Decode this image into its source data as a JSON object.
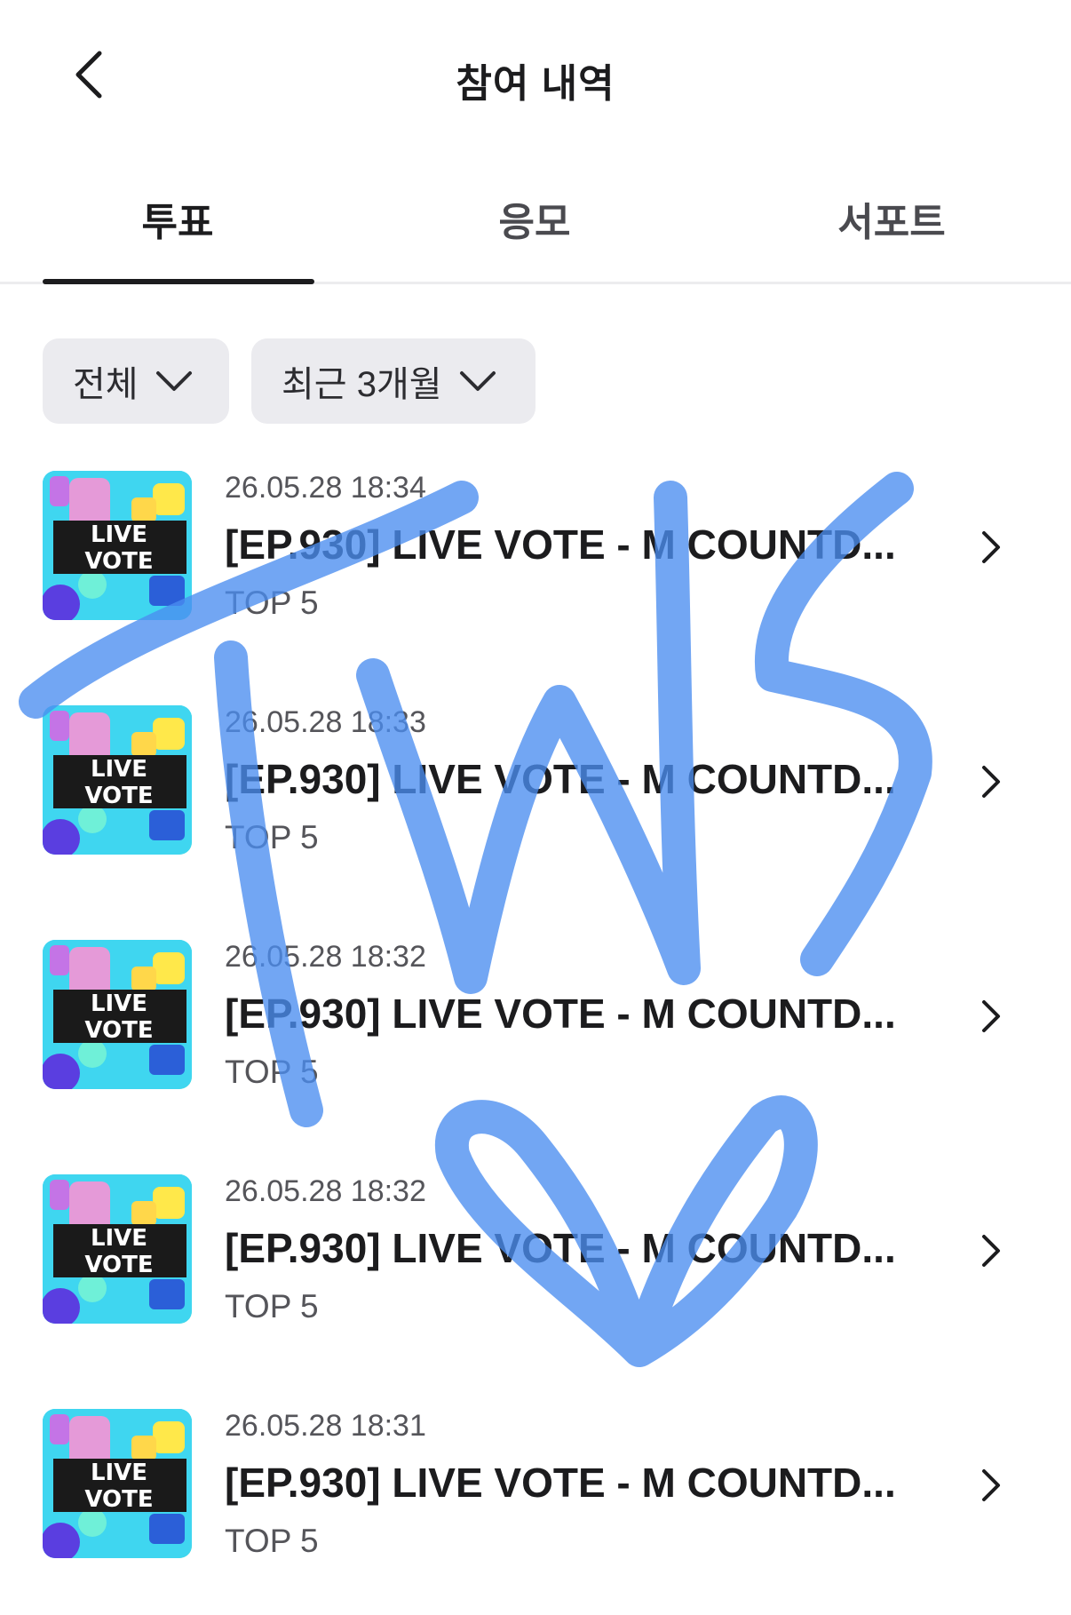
{
  "header": {
    "title": "참여 내역",
    "back_icon": "chevron-left-icon"
  },
  "tabs": [
    {
      "label": "투표",
      "active": true
    },
    {
      "label": "응모",
      "active": false
    },
    {
      "label": "서포트",
      "active": false
    }
  ],
  "filters": {
    "category": {
      "value": "전체",
      "icon": "chevron-down-icon"
    },
    "period": {
      "value": "최근 3개월",
      "icon": "chevron-down-icon"
    }
  },
  "items": [
    {
      "date": "26.05.28 18:34",
      "title": "[EP.930] LIVE VOTE - M COUNTD...",
      "subtitle": "TOP 5",
      "thumb_text": [
        "LIVE",
        "VOTE"
      ]
    },
    {
      "date": "26.05.28 18:33",
      "title": "[EP.930] LIVE VOTE - M COUNTD...",
      "subtitle": "TOP 5",
      "thumb_text": [
        "LIVE",
        "VOTE"
      ]
    },
    {
      "date": "26.05.28 18:32",
      "title": "[EP.930] LIVE VOTE - M COUNTD...",
      "subtitle": "TOP 5",
      "thumb_text": [
        "LIVE",
        "VOTE"
      ]
    },
    {
      "date": "26.05.28 18:32",
      "title": "[EP.930] LIVE VOTE - M COUNTD...",
      "subtitle": "TOP 5",
      "thumb_text": [
        "LIVE",
        "VOTE"
      ]
    },
    {
      "date": "26.05.28 18:31",
      "title": "[EP.930] LIVE VOTE - M COUNTD...",
      "subtitle": "TOP 5",
      "thumb_text": [
        "LIVE",
        "VOTE"
      ]
    }
  ],
  "overlay": {
    "text": "TWS",
    "color": "#4a8df0"
  },
  "colors": {
    "text_primary": "#1c1c1e",
    "text_secondary": "#55555a",
    "filter_bg": "#ebebef",
    "tab_indicator": "#1c1c1e"
  }
}
